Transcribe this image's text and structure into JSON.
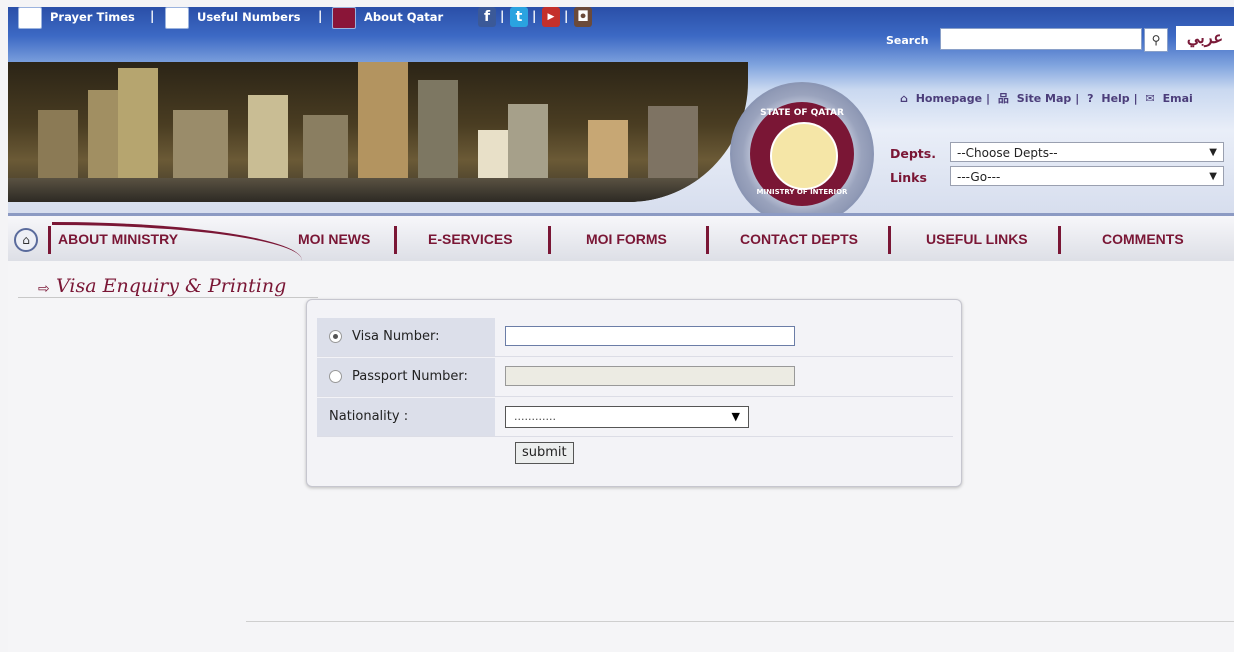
{
  "topbar": {
    "prayer_times": "Prayer Times",
    "useful_numbers": "Useful Numbers",
    "about_qatar": "About Qatar",
    "separator": "|",
    "social_icons": [
      "facebook-icon",
      "twitter-icon",
      "youtube-icon",
      "instagram-icon"
    ]
  },
  "search": {
    "label": "Search",
    "placeholder": "",
    "value": ""
  },
  "language_link": "عربي",
  "header_links": [
    "Homepage",
    "Site Map",
    "Help",
    "Emai"
  ],
  "seal": {
    "top_text": "STATE OF QATAR",
    "bottom_text": "MINISTRY OF INTERIOR"
  },
  "selectors": {
    "depts_label": "Depts.",
    "depts_value": "--Choose Depts--",
    "links_label": "Links",
    "links_value": "---Go---"
  },
  "nav": {
    "items": [
      "ABOUT MINISTRY",
      "MOI NEWS",
      "E-SERVICES",
      "MOI FORMS",
      "CONTACT DEPTS",
      "USEFUL LINKS",
      "COMMENTS"
    ]
  },
  "page": {
    "title": "Visa Enquiry & Printing"
  },
  "form": {
    "visa_label": "Visa Number:",
    "passport_label": "Passport Number:",
    "nationality_label": "Nationality :",
    "nationality_value": "............",
    "submit_label": "submit",
    "selected_option": "visa"
  },
  "colors": {
    "brand_maroon": "#7a1635",
    "header_blue": "#2a4fa8",
    "nav_border": "#8c9ac3"
  }
}
